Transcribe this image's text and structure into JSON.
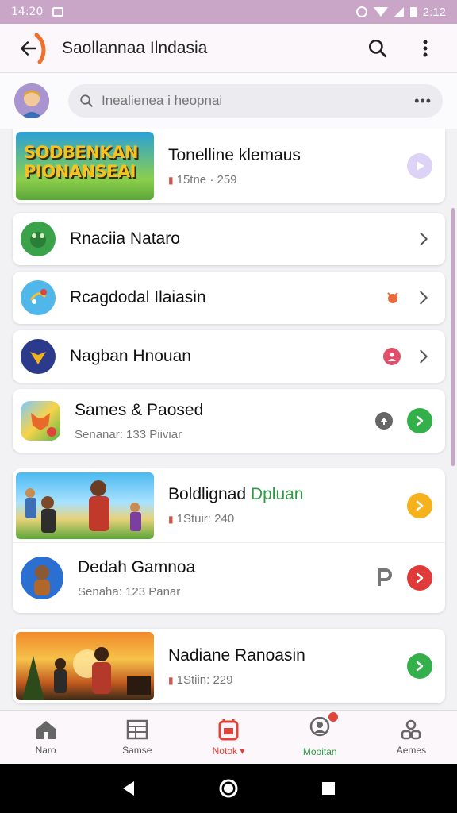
{
  "status_bar": {
    "time": "14:20",
    "right_text": "2:12"
  },
  "app_bar": {
    "title": "Saollannaa Ilndasia"
  },
  "search": {
    "placeholder": "Inealienea i heopnai",
    "more": "•••"
  },
  "items": [
    {
      "title": "Tonelline klemaus",
      "sub": "15tne · 259",
      "thumb_text": "SODBENKAN PIONANSEAI",
      "action_color": "#c7b6f0"
    },
    {
      "title": "Rnaciia Nataro"
    },
    {
      "title": "Rcagdodal Ilaiasin"
    },
    {
      "title": "Nagban Hnouan"
    },
    {
      "title": "Sames & Paosed",
      "sub": "Senanar: 133 Piiviar"
    },
    {
      "title": "Boldlignad",
      "title_accent": "Dpluan",
      "sub": "1Stuir: 240",
      "thumb_text": ""
    },
    {
      "title": "Dedah Gamnoa",
      "sub": "Senaha: 123 Panar"
    },
    {
      "title": "Nadiane Ranoasin",
      "sub": "1Stiin: 229",
      "thumb_text": ""
    }
  ],
  "bottom_nav": [
    {
      "label": "Naro",
      "icon": "home-icon"
    },
    {
      "label": "Samse",
      "icon": "grid-icon"
    },
    {
      "label": "Notok",
      "icon": "notebook-icon"
    },
    {
      "label": "Mooitan",
      "icon": "chat-user-icon"
    },
    {
      "label": "Aemes",
      "icon": "people-icon"
    }
  ],
  "colors": {
    "accent": "#e0433a",
    "green": "#34b04a",
    "yellow": "#f6b21d",
    "purple": "#c9a6c8"
  }
}
